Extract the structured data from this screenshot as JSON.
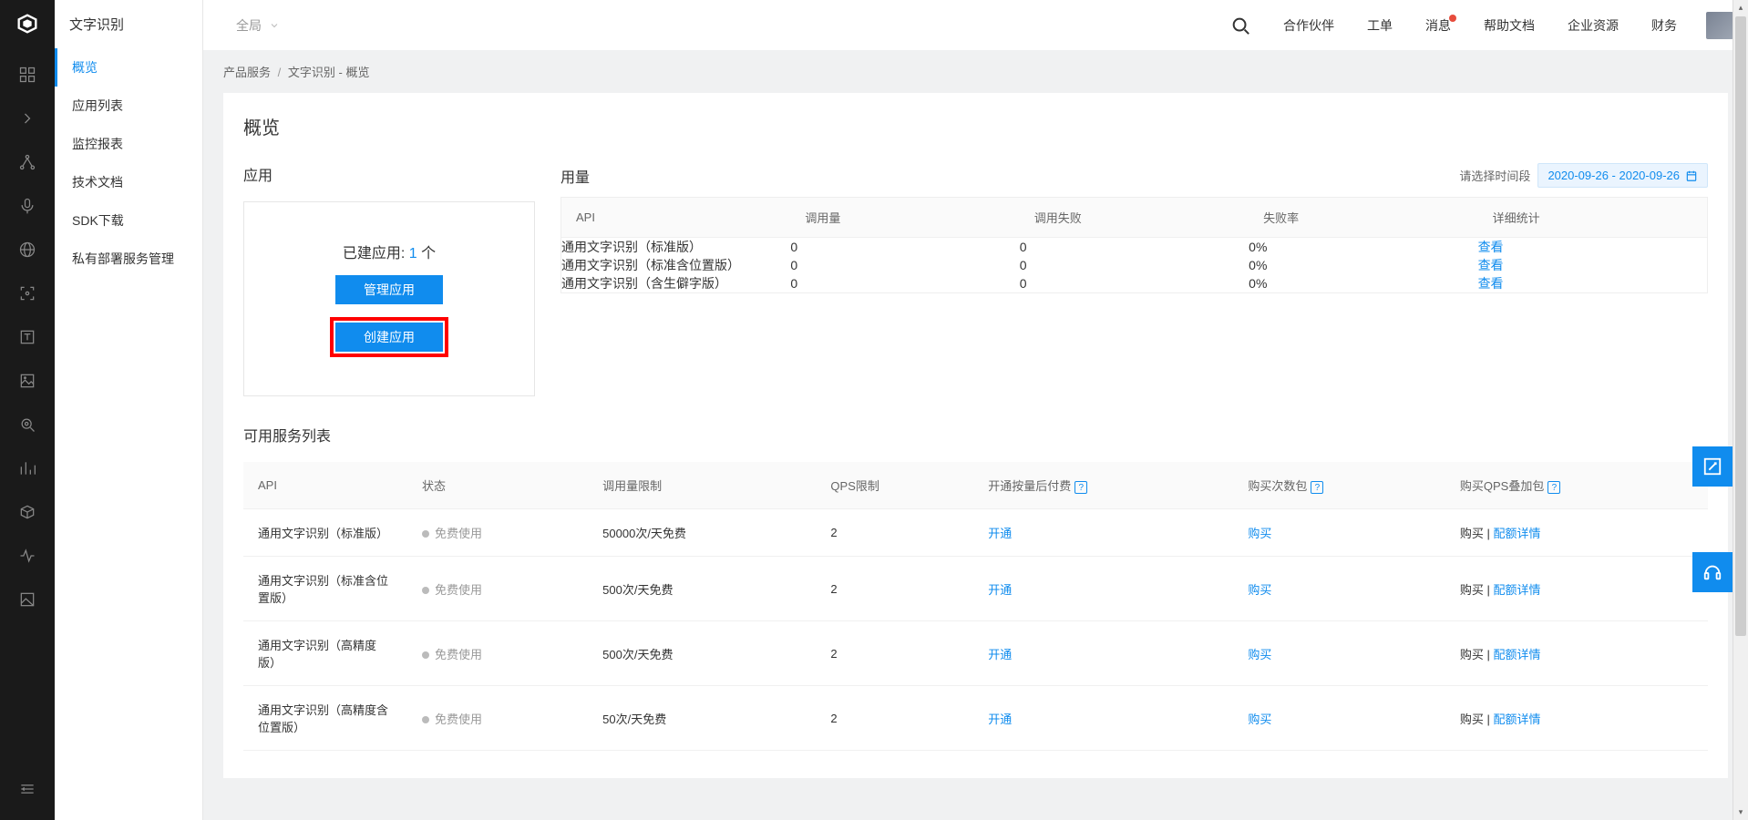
{
  "topbar": {
    "scope": "全局",
    "links": {
      "search": "search",
      "partner": "合作伙伴",
      "ticket": "工单",
      "message": "消息",
      "help": "帮助文档",
      "enterprise": "企业资源",
      "finance": "财务"
    }
  },
  "sidebar": {
    "title": "文字识别",
    "items": [
      {
        "label": "概览",
        "active": true
      },
      {
        "label": "应用列表"
      },
      {
        "label": "监控报表"
      },
      {
        "label": "技术文档"
      },
      {
        "label": "SDK下载"
      },
      {
        "label": "私有部署服务管理"
      }
    ]
  },
  "breadcrumb": {
    "a": "产品服务",
    "b": "文字识别 - 概览"
  },
  "page_title": "概览",
  "app_section": {
    "title": "应用",
    "count_prefix": "已建应用: ",
    "count_value": "1",
    "count_suffix": " 个",
    "manage_label": "管理应用",
    "create_label": "创建应用"
  },
  "usage_section": {
    "title": "用量",
    "date_label": "请选择时间段",
    "date_range": "2020-09-26 - 2020-09-26",
    "headers": {
      "api": "API",
      "calls": "调用量",
      "fail": "调用失败",
      "rate": "失败率",
      "detail": "详细统计"
    },
    "rows": [
      {
        "api": "通用文字识别（标准版）",
        "calls": "0",
        "fail": "0",
        "rate": "0%",
        "detail": "查看"
      },
      {
        "api": "通用文字识别（标准含位置版）",
        "calls": "0",
        "fail": "0",
        "rate": "0%",
        "detail": "查看"
      },
      {
        "api": "通用文字识别（含生僻字版）",
        "calls": "0",
        "fail": "0",
        "rate": "0%",
        "detail": "查看"
      }
    ]
  },
  "services_section": {
    "title": "可用服务列表",
    "headers": {
      "api": "API",
      "status": "状态",
      "quota": "调用量限制",
      "qps": "QPS限制",
      "postpay": "开通按量后付费",
      "buycount": "购买次数包",
      "buyqps": "购买QPS叠加包"
    },
    "free_label": "免费使用",
    "open_label": "开通",
    "buy_label": "购买",
    "buy_plain": "购买",
    "quota_link": "配额详情",
    "rows": [
      {
        "api": "通用文字识别（标准版）",
        "quota": "50000次/天免费",
        "qps": "2"
      },
      {
        "api": "通用文字识别（标准含位置版）",
        "quota": "500次/天免费",
        "qps": "2"
      },
      {
        "api": "通用文字识别（高精度版）",
        "quota": "500次/天免费",
        "qps": "2"
      },
      {
        "api": "通用文字识别（高精度含位置版）",
        "quota": "50次/天免费",
        "qps": "2"
      }
    ]
  }
}
